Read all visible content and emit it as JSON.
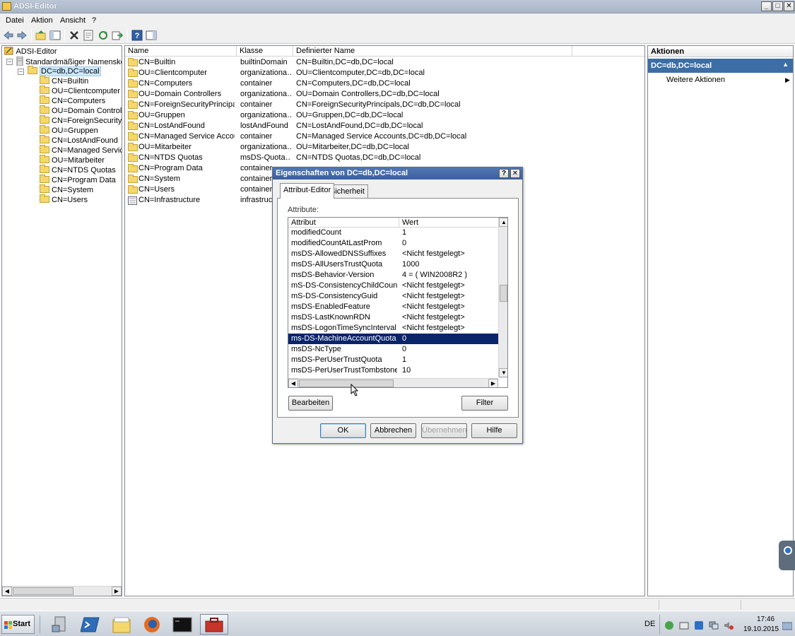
{
  "window": {
    "title": "ADSI-Editor",
    "min": "_",
    "max": "□",
    "close": "✕"
  },
  "menu": {
    "items": [
      "Datei",
      "Aktion",
      "Ansicht",
      "?"
    ]
  },
  "tree": {
    "root": "ADSI-Editor",
    "context": "Standardmäßiger Namenskonte",
    "domain": "DC=db,DC=local",
    "children": [
      "CN=Builtin",
      "OU=Clientcomputer",
      "CN=Computers",
      "OU=Domain Controllers",
      "CN=ForeignSecurityPri",
      "OU=Gruppen",
      "CN=LostAndFound",
      "CN=Managed Service A",
      "OU=Mitarbeiter",
      "CN=NTDS Quotas",
      "CN=Program Data",
      "CN=System",
      "CN=Users"
    ]
  },
  "list": {
    "columns": [
      "Name",
      "Klasse",
      "Definierter Name"
    ],
    "rows": [
      [
        "CN=Builtin",
        "builtinDomain",
        "CN=Builtin,DC=db,DC=local"
      ],
      [
        "OU=Clientcomputer",
        "organizationa…",
        "OU=Clientcomputer,DC=db,DC=local"
      ],
      [
        "CN=Computers",
        "container",
        "CN=Computers,DC=db,DC=local"
      ],
      [
        "OU=Domain Controllers",
        "organizationa…",
        "OU=Domain Controllers,DC=db,DC=local"
      ],
      [
        "CN=ForeignSecurityPrincipals",
        "container",
        "CN=ForeignSecurityPrincipals,DC=db,DC=local"
      ],
      [
        "OU=Gruppen",
        "organizationa…",
        "OU=Gruppen,DC=db,DC=local"
      ],
      [
        "CN=LostAndFound",
        "lostAndFound",
        "CN=LostAndFound,DC=db,DC=local"
      ],
      [
        "CN=Managed Service Accounts",
        "container",
        "CN=Managed Service Accounts,DC=db,DC=local"
      ],
      [
        "OU=Mitarbeiter",
        "organizationa…",
        "OU=Mitarbeiter,DC=db,DC=local"
      ],
      [
        "CN=NTDS Quotas",
        "msDS-Quota…",
        "CN=NTDS Quotas,DC=db,DC=local"
      ],
      [
        "CN=Program Data",
        "container",
        ""
      ],
      [
        "CN=System",
        "container",
        ""
      ],
      [
        "CN=Users",
        "container",
        ""
      ],
      [
        "CN=Infrastructure",
        "infrastructu",
        ""
      ]
    ]
  },
  "actions": {
    "header": "Aktionen",
    "selected": "DC=db,DC=local",
    "item": "Weitere Aktionen"
  },
  "dialog": {
    "title": "Eigenschaften von DC=db,DC=local",
    "help": "?",
    "close": "✕",
    "tabs": [
      "Attribut-Editor",
      "Sicherheit"
    ],
    "attributes_label": "Attribute:",
    "columns": [
      "Attribut",
      "Wert"
    ],
    "rows": [
      [
        "modifiedCount",
        "1"
      ],
      [
        "modifiedCountAtLastProm",
        "0"
      ],
      [
        "msDS-AllowedDNSSuffixes",
        "<Nicht festgelegt>"
      ],
      [
        "msDS-AllUsersTrustQuota",
        "1000"
      ],
      [
        "msDS-Behavior-Version",
        "4 = ( WIN2008R2 )"
      ],
      [
        "mS-DS-ConsistencyChildCount",
        "<Nicht festgelegt>"
      ],
      [
        "mS-DS-ConsistencyGuid",
        "<Nicht festgelegt>"
      ],
      [
        "msDS-EnabledFeature",
        "<Nicht festgelegt>"
      ],
      [
        "msDS-LastKnownRDN",
        "<Nicht festgelegt>"
      ],
      [
        "msDS-LogonTimeSyncInterval",
        "<Nicht festgelegt>"
      ],
      [
        "ms-DS-MachineAccountQuota",
        "0"
      ],
      [
        "msDS-NcType",
        "0"
      ],
      [
        "msDS-PerUserTrustQuota",
        "1"
      ],
      [
        "msDS-PerUserTrustTombstonesQ...",
        "10"
      ]
    ],
    "selected_row": "ms-DS-MachineAccountQuota",
    "edit_button": "Bearbeiten",
    "filter_button": "Filter",
    "ok": "OK",
    "cancel": "Abbrechen",
    "apply": "Übernehmen",
    "help_button": "Hilfe"
  },
  "taskbar": {
    "start": "Start",
    "lang": "DE",
    "time": "17:46",
    "date": "19.10.2015"
  },
  "colors": {
    "selection": "#0a246a",
    "action_header": "#3c6ea5",
    "title_gradient": "#3b5f9d"
  }
}
